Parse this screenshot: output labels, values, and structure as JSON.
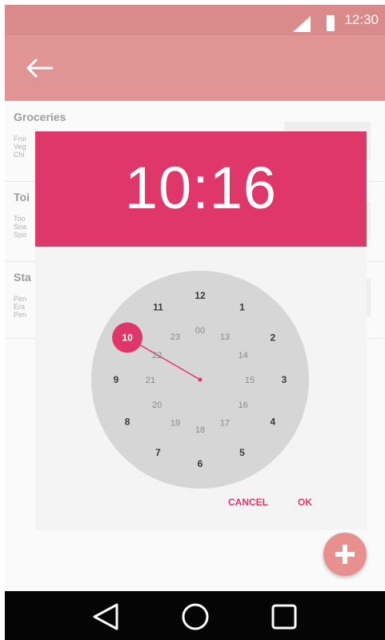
{
  "status_bar": {
    "time": "12:30",
    "icons": [
      "signal-icon",
      "battery-icon"
    ]
  },
  "app_bar": {
    "back_icon": "back-arrow-icon"
  },
  "list": {
    "sections": [
      {
        "title": "Groceries",
        "lines": [
          "Frui",
          "Veg",
          "Chi"
        ]
      },
      {
        "title": "Toi",
        "lines": [
          "Too",
          "Soa",
          "Spo"
        ]
      },
      {
        "title": "Sta",
        "lines": [
          "Pen",
          "Era",
          "Pen"
        ]
      }
    ]
  },
  "time_picker": {
    "time": "10:16",
    "selected_hour": "10",
    "outer_hours": [
      "12",
      "1",
      "2",
      "3",
      "4",
      "5",
      "6",
      "7",
      "8",
      "9",
      "10",
      "11"
    ],
    "inner_hours": [
      "00",
      "13",
      "14",
      "15",
      "16",
      "17",
      "18",
      "19",
      "20",
      "21",
      "22",
      "23"
    ],
    "accent_color": "#e0376a",
    "buttons": {
      "cancel": "CANCEL",
      "ok": "OK"
    }
  },
  "fab": {
    "icon": "plus-icon"
  },
  "nav_bar": {
    "icons": [
      "back-triangle-icon",
      "home-circle-icon",
      "recents-square-icon"
    ]
  }
}
